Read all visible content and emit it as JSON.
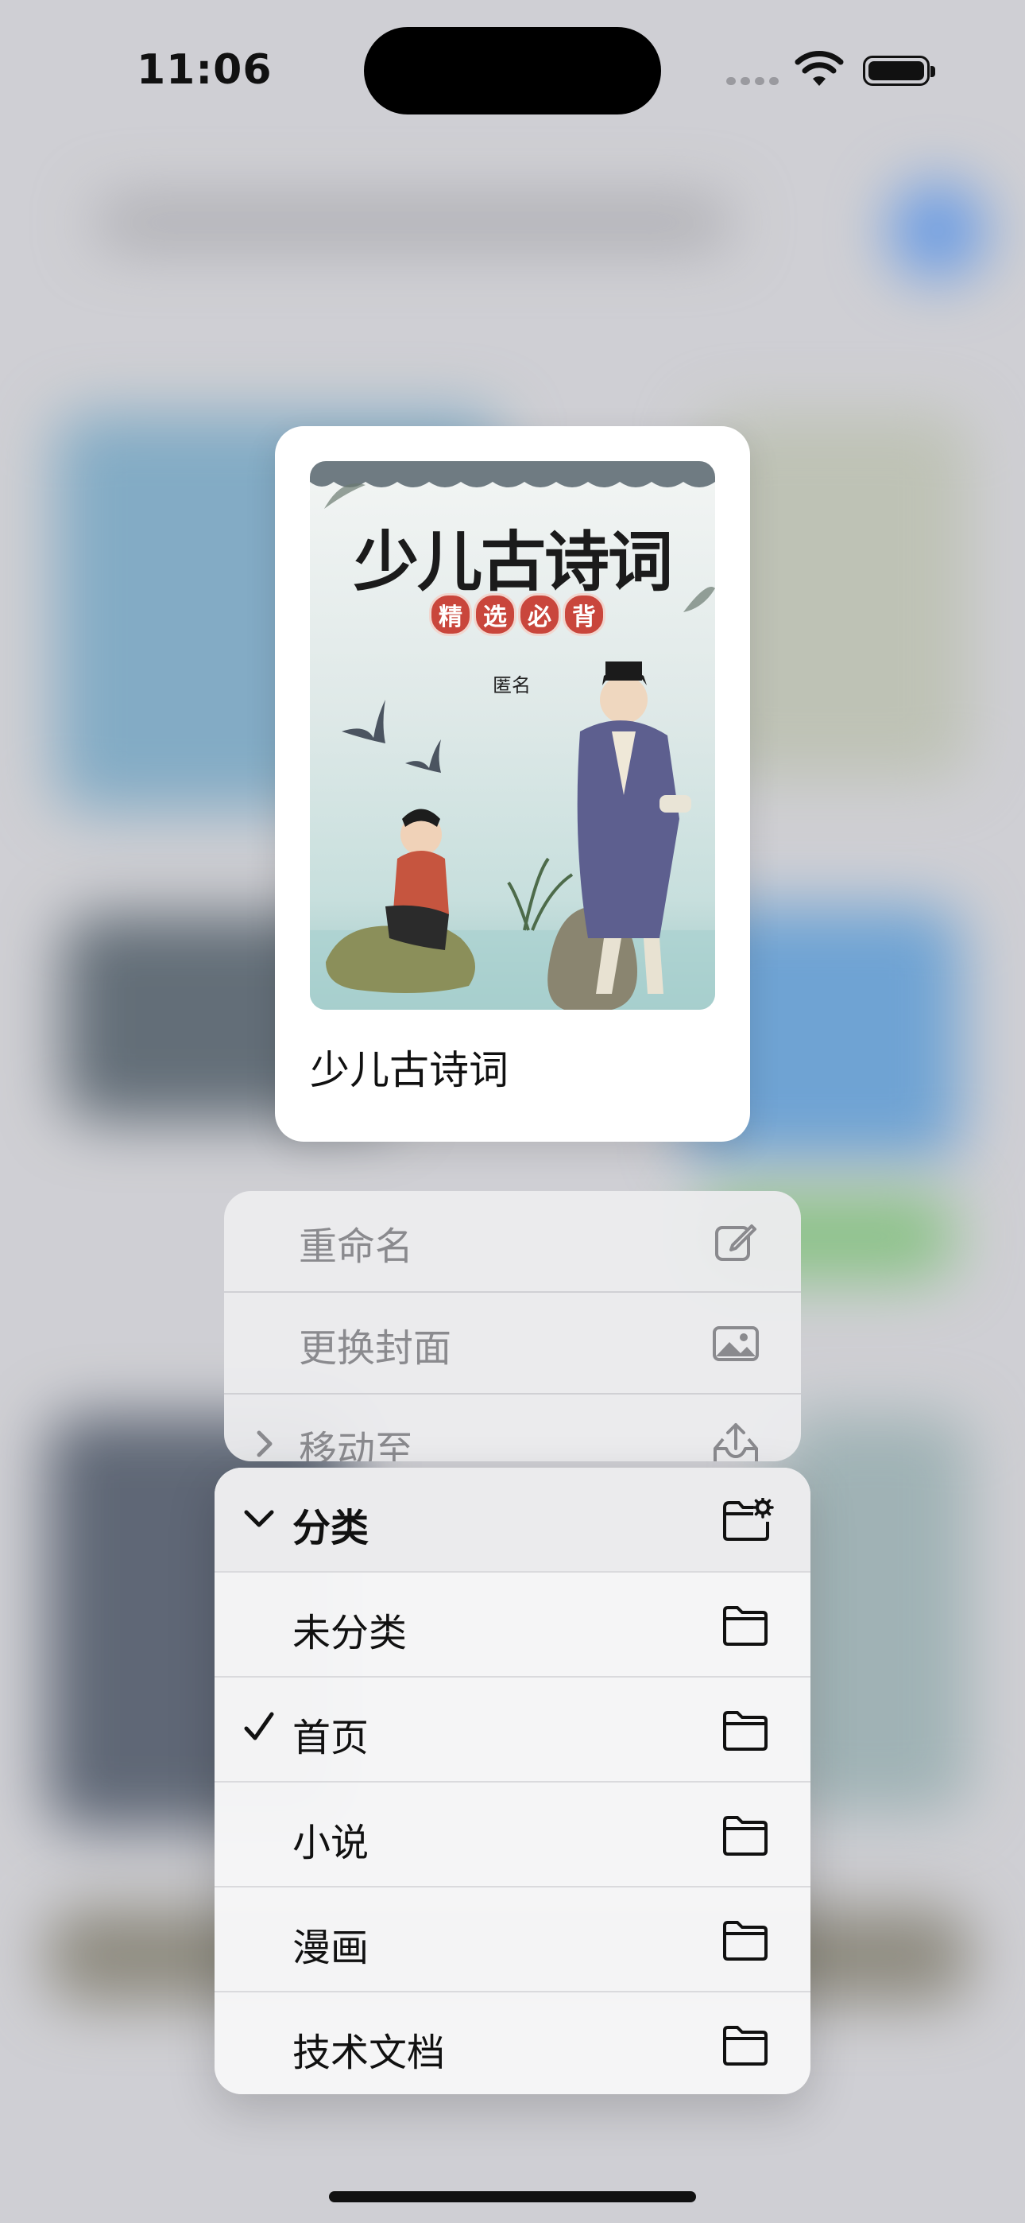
{
  "status_bar": {
    "time": "11:06"
  },
  "preview": {
    "cover_title": "少儿古诗词",
    "cover_badges": [
      "精",
      "选",
      "必",
      "背"
    ],
    "cover_author": "匿名",
    "title": "少儿古诗词"
  },
  "menu": {
    "items": [
      {
        "label": "重命名",
        "icon": "square-and-pencil-icon"
      },
      {
        "label": "更换封面",
        "icon": "photo-icon"
      },
      {
        "label": "移动至",
        "icon": "tray-and-arrow-up-icon"
      }
    ]
  },
  "submenu": {
    "header": {
      "label": "分类",
      "icon": "folder-badge-gear-icon"
    },
    "items": [
      {
        "label": "未分类",
        "checked": false,
        "icon": "folder-icon"
      },
      {
        "label": "首页",
        "checked": true,
        "icon": "folder-icon"
      },
      {
        "label": "小说",
        "checked": false,
        "icon": "folder-icon"
      },
      {
        "label": "漫画",
        "checked": false,
        "icon": "folder-icon"
      },
      {
        "label": "技术文档",
        "checked": false,
        "icon": "folder-icon"
      }
    ]
  }
}
